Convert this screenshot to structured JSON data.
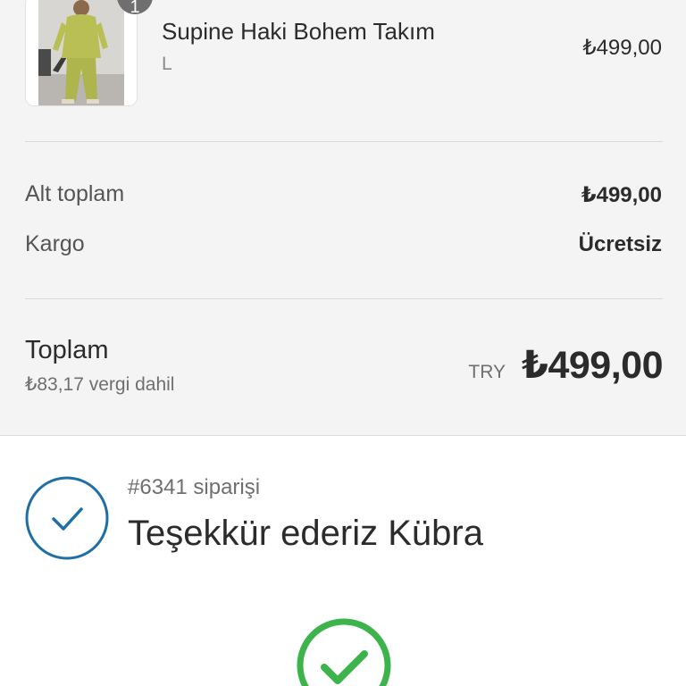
{
  "product": {
    "name": "Supine Haki Bohem Takım",
    "variant": "L",
    "price": "₺499,00",
    "quantity": "1",
    "image_icon": "product-photo-khaki-set"
  },
  "summary": {
    "subtotal_label": "Alt toplam",
    "subtotal_value": "₺499,00",
    "shipping_label": "Kargo",
    "shipping_value": "Ücretsiz",
    "total_label": "Toplam",
    "tax_note": "₺83,17 vergi dahil",
    "currency_code": "TRY",
    "total_value": "₺499,00"
  },
  "confirmation": {
    "order_number": "#6341 siparişi",
    "thanks_title": "Teşekkür ederiz Kübra",
    "check_icon": "check-circle-icon",
    "success_icon": "success-check-icon"
  },
  "colors": {
    "summary_background": "#f4f4f4",
    "confirm_blue": "#1f6fa6",
    "success_green": "#3cb44b",
    "text_dark": "#2b2b2b",
    "text_muted": "#6f6f6f"
  }
}
